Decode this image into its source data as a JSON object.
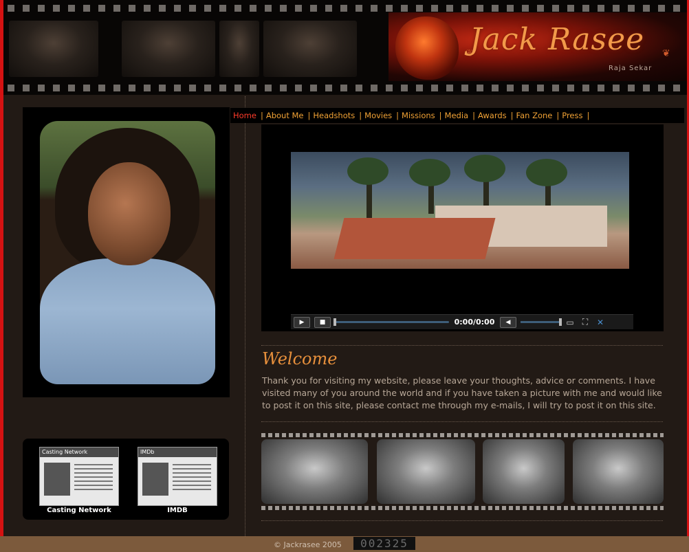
{
  "brand": {
    "title": "Jack Rasee",
    "subtitle": "Raja Sekar"
  },
  "nav": {
    "items": [
      {
        "label": "Home",
        "active": true
      },
      {
        "label": "About Me"
      },
      {
        "label": "Headshots"
      },
      {
        "label": "Movies"
      },
      {
        "label": "Missions"
      },
      {
        "label": "Media"
      },
      {
        "label": "Awards"
      },
      {
        "label": "Fan Zone"
      },
      {
        "label": "Press"
      }
    ],
    "separator": "|"
  },
  "player": {
    "time": "0:00/0:00",
    "icons": [
      "play-icon",
      "stop-icon",
      "mute-icon",
      "minimize-icon",
      "fullscreen-icon",
      "close-icon"
    ]
  },
  "welcome": {
    "heading": "Welcome",
    "text": "Thank you for visiting my website, please leave your thoughts, advice or comments.  I have visited many of you around the world and if you have taken a picture with me and would like to post it on this site, please contact me through my e-mails, I will try to post it on this site."
  },
  "links": {
    "casting": {
      "label": "Casting Network",
      "thumb_title": "Casting Network"
    },
    "imdb": {
      "label": "IMDB",
      "thumb_title": "IMDb"
    }
  },
  "footer": {
    "copyright": "© Jackrasee 2005",
    "counter": "002325"
  },
  "colors": {
    "frame": "#d41212",
    "accent": "#f1a235",
    "active": "#ff3b2a",
    "background": "#221a15",
    "footer": "#7c5a3c"
  }
}
